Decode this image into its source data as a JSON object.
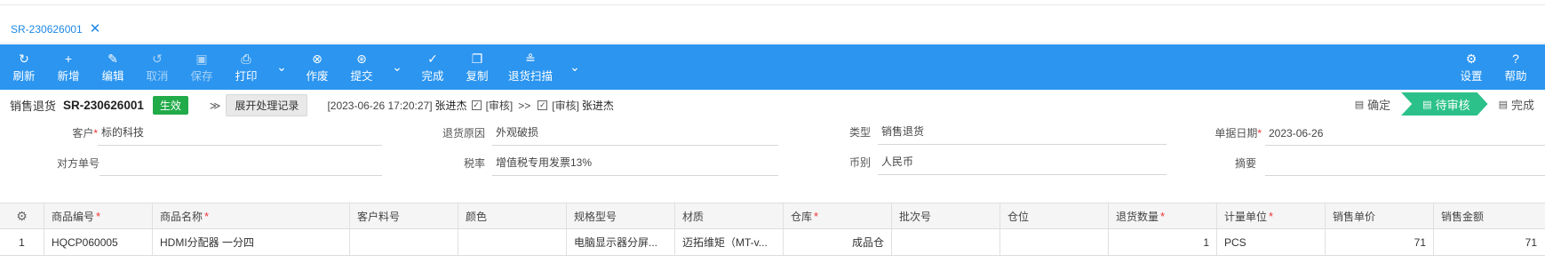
{
  "tab": {
    "title": "SR-230626001",
    "close": "✕"
  },
  "toolbar": {
    "items": [
      {
        "label": "刷新",
        "icon": "↻"
      },
      {
        "label": "新增",
        "icon": "+"
      },
      {
        "label": "编辑",
        "icon": "✎"
      },
      {
        "label": "取消",
        "icon": "↺"
      },
      {
        "label": "保存",
        "icon": "▣"
      },
      {
        "label": "打印",
        "icon": "⎙"
      },
      {
        "label": "作废",
        "icon": "⊗"
      },
      {
        "label": "提交",
        "icon": "⊛"
      },
      {
        "label": "完成",
        "icon": "✓"
      },
      {
        "label": "复制",
        "icon": "❐"
      },
      {
        "label": "退货扫描",
        "icon": "≗"
      },
      {
        "label": "设置",
        "icon": "⚙"
      },
      {
        "label": "帮助",
        "icon": "?"
      }
    ],
    "dropdown": "⌄"
  },
  "header": {
    "doc_type": "销售退货",
    "doc_no": "SR-230626001",
    "status": "生效",
    "expand_icon": "≫",
    "expand_log_button": "展开处理记录",
    "log": {
      "time": "[2023-06-26 17:20:27]",
      "user1": "张进杰",
      "action1": "[审核]",
      "arrow": ">>",
      "action2": "[审核]",
      "user2": "张进杰"
    }
  },
  "steps": [
    {
      "label": "确定",
      "icon": "▤"
    },
    {
      "label": "待审核",
      "icon": "▤"
    },
    {
      "label": "完成",
      "icon": "▤"
    }
  ],
  "form": {
    "customer": {
      "label": "客户",
      "value": "标的科技"
    },
    "return_reason": {
      "label": "退货原因",
      "value": "外观破损"
    },
    "type": {
      "label": "类型",
      "value": "销售退货"
    },
    "doc_date": {
      "label": "单据日期",
      "value": "2023-06-26"
    },
    "counterparty_no": {
      "label": "对方单号",
      "value": ""
    },
    "tax_rate": {
      "label": "税率",
      "value": "增值税专用发票13%"
    },
    "currency": {
      "label": "币别",
      "value": "人民币"
    },
    "summary": {
      "label": "摘要",
      "value": ""
    }
  },
  "grid": {
    "settings_icon": "⚙",
    "columns": [
      "商品编号",
      "商品名称",
      "客户料号",
      "颜色",
      "规格型号",
      "材质",
      "仓库",
      "批次号",
      "仓位",
      "退货数量",
      "计量单位",
      "销售单价",
      "销售金额"
    ],
    "required": [
      true,
      true,
      false,
      false,
      false,
      false,
      true,
      false,
      false,
      true,
      true,
      false,
      false
    ],
    "rows": [
      [
        "1",
        "HQCP060005",
        "HDMI分配器 一分四",
        "",
        "",
        "电脑显示器分屏...",
        "迈拓维矩（MT-v...",
        "成品仓",
        "",
        "",
        "1",
        "PCS",
        "71",
        "71"
      ]
    ]
  },
  "colors": {
    "toolbar": "#2b95f0",
    "status": "#21ab49",
    "step_active": "#2cc18b",
    "accent": "#1e88e5"
  }
}
